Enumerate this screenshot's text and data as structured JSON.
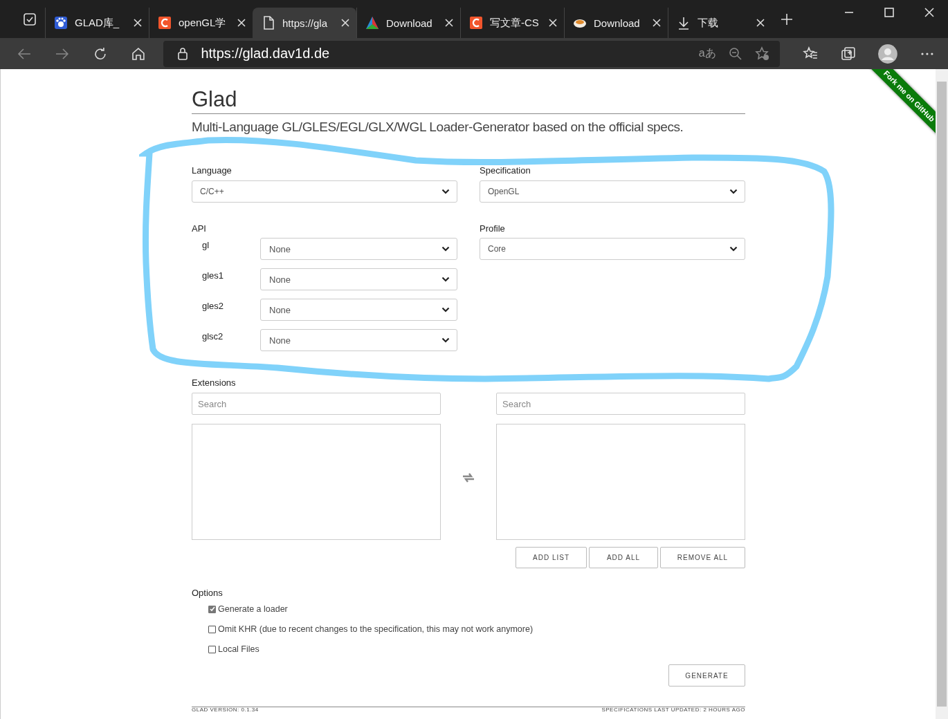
{
  "browser": {
    "tabs": [
      {
        "title": "GLAD库_",
        "kind": "paw",
        "selected": false
      },
      {
        "title": "openGL学",
        "kind": "csdn",
        "selected": false
      },
      {
        "title": "https://gla",
        "kind": "page",
        "selected": true
      },
      {
        "title": "Download",
        "kind": "triangle",
        "selected": false
      },
      {
        "title": "写文章-CS",
        "kind": "csdn",
        "selected": false
      },
      {
        "title": "Download",
        "kind": "cup",
        "selected": false
      },
      {
        "title": "下载",
        "kind": "download",
        "selected": false
      }
    ],
    "address": "https://glad.dav1d.de",
    "translate": "aあ"
  },
  "page": {
    "title": "Glad",
    "subtitle": "Multi-Language GL/GLES/EGL/GLX/WGL Loader-Generator based on the official specs.",
    "language": {
      "label": "Language",
      "value": "C/C++"
    },
    "specification": {
      "label": "Specification",
      "value": "OpenGL"
    },
    "api": {
      "label": "API",
      "rows": [
        {
          "name": "gl",
          "value": "None"
        },
        {
          "name": "gles1",
          "value": "None"
        },
        {
          "name": "gles2",
          "value": "None"
        },
        {
          "name": "glsc2",
          "value": "None"
        }
      ]
    },
    "profile": {
      "label": "Profile",
      "value": "Core"
    },
    "extensions": {
      "label": "Extensions",
      "search_left": {
        "placeholder": "Search"
      },
      "search_right": {
        "placeholder": "Search"
      },
      "buttons": [
        "ADD LIST",
        "ADD ALL",
        "REMOVE ALL"
      ]
    },
    "options": {
      "label": "Options",
      "items": [
        {
          "label": "Generate a loader",
          "checked": true
        },
        {
          "label": "Omit KHR (due to recent changes to the specification, this may not work anymore)",
          "checked": false
        },
        {
          "label": "Local Files",
          "checked": false
        }
      ]
    },
    "generate": "GENERATE",
    "footer": {
      "version": "GLAD VERSION: 0.1.34",
      "updated": "SPECIFICATIONS LAST UPDATED: 2 HOURS AGO"
    },
    "ribbon": "Fork me on GitHub"
  }
}
